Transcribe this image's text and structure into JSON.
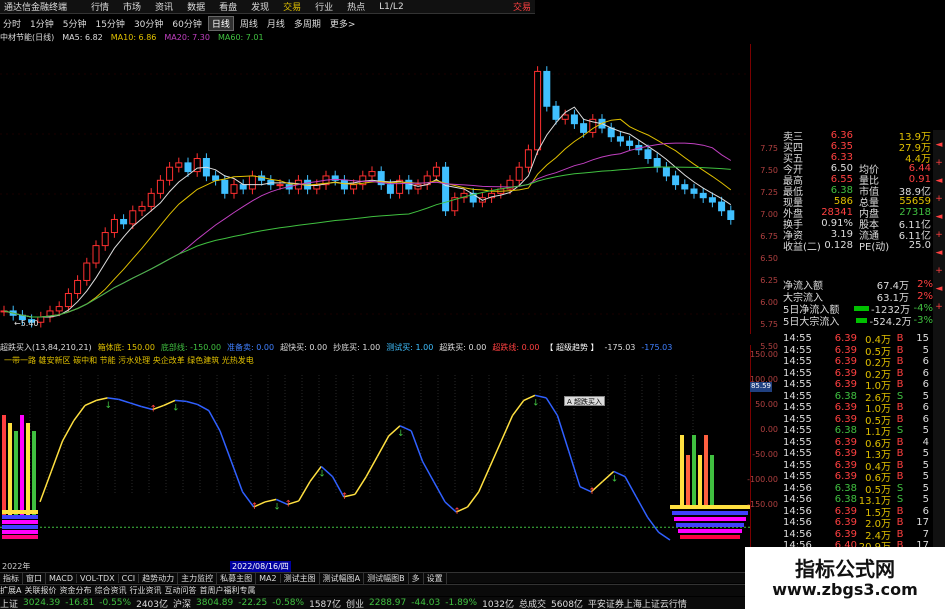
{
  "titlebar": {
    "app_name": "通达信金融终端",
    "menus": [
      "行情",
      "市场",
      "资讯",
      "数据",
      "看盘",
      "发现",
      "交易",
      "行业",
      "热点",
      "L1/L2"
    ],
    "right_label": "交易"
  },
  "period_tabs": [
    "分时",
    "1分钟",
    "5分钟",
    "15分钟",
    "30分钟",
    "60分钟",
    "日线",
    "周线",
    "月线",
    "多周期",
    "更多>"
  ],
  "active_period": "日线",
  "ma_info": {
    "name": "中材节能(日线)",
    "ma5": "MA5: 6.82",
    "ma10": "MA10: 6.86",
    "ma20": "MA20: 7.30",
    "ma60": "MA60: 7.01"
  },
  "low_marker": "5.40",
  "price_axis": [
    "7.75",
    "7.50",
    "7.25",
    "7.00",
    "6.75",
    "6.50",
    "6.25",
    "6.00",
    "5.75",
    "5.50"
  ],
  "indicator_info": [
    {
      "text": "超跌买入(13,84,210,21)",
      "color": "#dddddd"
    },
    {
      "text": "箱体底: 150.00",
      "color": "#e0c000"
    },
    {
      "text": "底部线: -150.00",
      "color": "#40c040"
    },
    {
      "text": "准备卖: 0.00",
      "color": "#4080ff"
    },
    {
      "text": "超快买: 0.00",
      "color": "#dddddd"
    },
    {
      "text": "抄底买: 1.00",
      "color": "#dddddd"
    },
    {
      "text": "测试买: 1.00",
      "color": "#40c0ff"
    },
    {
      "text": "超跌买: 0.00",
      "color": "#dddddd"
    },
    {
      "text": "超跌线: 0.00",
      "color": "#ff4040"
    },
    {
      "text": "【 超级趋势 】",
      "color": "#ffffff"
    },
    {
      "text": "-175.03",
      "color": "#dddddd"
    },
    {
      "text": "-175.03",
      "color": "#4080ff"
    }
  ],
  "tagline": "一带一路 雄安新区 碳中和 节能 污水处理 央企改革 绿色建筑 光热发电",
  "indicator_axis": [
    "150.00",
    "100.00",
    "50.00",
    "0.00",
    "-50.00",
    "-100.00",
    "-150.00"
  ],
  "indicator_flag": "85.59",
  "tooltip_text": "A 超跌买入",
  "year_label": "2022年",
  "date_label": "2022/08/16/四",
  "quote": [
    {
      "l1": "卖三",
      "v1": "6.36",
      "c1": "#ff4040",
      "l2": "",
      "v2": "13.9万",
      "c2": "#e0c000"
    },
    {
      "l1": "买四",
      "v1": "6.35",
      "c1": "#ff4040",
      "l2": "",
      "v2": "27.9万",
      "c2": "#e0c000"
    },
    {
      "l1": "买五",
      "v1": "6.33",
      "c1": "#ff4040",
      "l2": "",
      "v2": "4.4万",
      "c2": "#e0c000"
    },
    {
      "l1": "今开",
      "v1": "6.50",
      "c1": "#dddddd",
      "l2": "均价",
      "v2": "6.44",
      "c2": "#ff4040"
    },
    {
      "l1": "最高",
      "v1": "6.55",
      "c1": "#ff4040",
      "l2": "量比",
      "v2": "0.91",
      "c2": "#ff4040"
    },
    {
      "l1": "最低",
      "v1": "6.38",
      "c1": "#40c040",
      "l2": "市值",
      "v2": "38.9亿",
      "c2": "#dddddd"
    },
    {
      "l1": "现量",
      "v1": "586",
      "c1": "#e0c000",
      "l2": "总量",
      "v2": "55659",
      "c2": "#e0c000"
    },
    {
      "l1": "外盘",
      "v1": "28341",
      "c1": "#ff4040",
      "l2": "内盘",
      "v2": "27318",
      "c2": "#40c040"
    },
    {
      "l1": "换手",
      "v1": "0.91%",
      "c1": "#dddddd",
      "l2": "股本",
      "v2": "6.11亿",
      "c2": "#dddddd"
    },
    {
      "l1": "净资",
      "v1": "3.19",
      "c1": "#dddddd",
      "l2": "流通",
      "v2": "6.11亿",
      "c2": "#dddddd"
    },
    {
      "l1": "收益(二)",
      "v1": "0.128",
      "c1": "#dddddd",
      "l2": "PE(动)",
      "v2": "25.0",
      "c2": "#dddddd"
    }
  ],
  "flow": [
    {
      "label": "净流入额",
      "bar_fraction": 0.0,
      "bar_color": "#ff4040",
      "value": "67.4万",
      "pct": "2%"
    },
    {
      "label": "大宗流入",
      "bar_fraction": 0.0,
      "bar_color": "#ff4040",
      "value": "63.1万",
      "pct": "2%"
    },
    {
      "label": "5日净流入额",
      "bar_fraction": 0.8,
      "bar_color": "#00c000",
      "value": "-1232万",
      "pct": "-4%"
    },
    {
      "label": "5日大宗流入",
      "bar_fraction": 0.6,
      "bar_color": "#00c000",
      "value": "-524.2万",
      "pct": "-3%"
    }
  ],
  "ticks": [
    {
      "t": "14:55",
      "p": "6.39",
      "v": "0.4万",
      "s": "B",
      "n": "15"
    },
    {
      "t": "14:55",
      "p": "6.39",
      "v": "0.5万",
      "s": "B",
      "n": "5"
    },
    {
      "t": "14:55",
      "p": "6.39",
      "v": "0.2万",
      "s": "B",
      "n": "6"
    },
    {
      "t": "14:55",
      "p": "6.39",
      "v": "0.2万",
      "s": "B",
      "n": "6"
    },
    {
      "t": "14:55",
      "p": "6.39",
      "v": "1.0万",
      "s": "B",
      "n": "6"
    },
    {
      "t": "14:55",
      "p": "6.38",
      "v": "2.6万",
      "s": "S",
      "n": "5"
    },
    {
      "t": "14:55",
      "p": "6.39",
      "v": "1.0万",
      "s": "B",
      "n": "6"
    },
    {
      "t": "14:55",
      "p": "6.39",
      "v": "0.5万",
      "s": "B",
      "n": "6"
    },
    {
      "t": "14:55",
      "p": "6.38",
      "v": "1.1万",
      "s": "S",
      "n": "5"
    },
    {
      "t": "14:55",
      "p": "6.39",
      "v": "0.6万",
      "s": "B",
      "n": "4"
    },
    {
      "t": "14:55",
      "p": "6.39",
      "v": "1.3万",
      "s": "B",
      "n": "5"
    },
    {
      "t": "14:55",
      "p": "6.39",
      "v": "0.4万",
      "s": "B",
      "n": "5"
    },
    {
      "t": "14:55",
      "p": "6.39",
      "v": "0.6万",
      "s": "B",
      "n": "5"
    },
    {
      "t": "14:56",
      "p": "6.38",
      "v": "0.5万",
      "s": "S",
      "n": "5"
    },
    {
      "t": "14:56",
      "p": "6.38",
      "v": "13.1万",
      "s": "S",
      "n": "5"
    },
    {
      "t": "14:56",
      "p": "6.39",
      "v": "1.5万",
      "s": "B",
      "n": "6"
    },
    {
      "t": "14:56",
      "p": "6.39",
      "v": "2.0万",
      "s": "B",
      "n": "17"
    },
    {
      "t": "14:56",
      "p": "6.39",
      "v": "2.4万",
      "s": "B",
      "n": "7"
    },
    {
      "t": "14:56",
      "p": "6.40",
      "v": "20.9万",
      "s": "B",
      "n": "17"
    },
    {
      "t": "14:56",
      "p": "6.40",
      "v": "1.7万",
      "s": "S",
      "n": "17"
    }
  ],
  "sidebar_buttons": [
    "◄",
    "+",
    "◄",
    "+",
    "◄",
    "+",
    "◄",
    "+",
    "◄",
    "+"
  ],
  "bottom_tabs": [
    "指标",
    "窗口",
    "MACD",
    "VOL-TDX",
    "CCI",
    "趋势动力",
    "主力监控",
    "私募主图",
    "MA2",
    "测试主图",
    "测试幅图A",
    "测试幅图B",
    "多",
    "设置"
  ],
  "statusbar": [
    "扩展A",
    "关联报价",
    "资金分布",
    "综合资讯",
    "行业资讯",
    "互动问答",
    "首周户福利专属"
  ],
  "indexbar": [
    {
      "text": "上证",
      "color": "#dddddd"
    },
    {
      "text": "3024.39",
      "color": "#40c040"
    },
    {
      "text": "-16.81",
      "color": "#40c040"
    },
    {
      "text": "-0.55%",
      "color": "#40c040"
    },
    {
      "text": "2403亿",
      "color": "#dddddd"
    },
    {
      "text": "沪深",
      "color": "#dddddd"
    },
    {
      "text": "3804.89",
      "color": "#40c040"
    },
    {
      "text": "-22.25",
      "color": "#40c040"
    },
    {
      "text": "-0.58%",
      "color": "#40c040"
    },
    {
      "text": "1587亿",
      "color": "#dddddd"
    },
    {
      "text": "创业",
      "color": "#dddddd"
    },
    {
      "text": "2288.97",
      "color": "#40c040"
    },
    {
      "text": "-44.03",
      "color": "#40c040"
    },
    {
      "text": "-1.89%",
      "color": "#40c040"
    },
    {
      "text": "1032亿",
      "color": "#dddddd"
    },
    {
      "text": "总成交",
      "color": "#dddddd"
    },
    {
      "text": "5608亿",
      "color": "#dddddd"
    },
    {
      "text": "平安证券上海上证云行情",
      "color": "#dddddd"
    }
  ],
  "watermark": {
    "line1": "指标公式网",
    "line2": "www.zbgs3.com"
  },
  "chart_data": {
    "type": "line",
    "candles_close": [
      5.55,
      5.5,
      5.45,
      5.42,
      5.48,
      5.55,
      5.6,
      5.75,
      5.9,
      6.1,
      6.3,
      6.45,
      6.6,
      6.55,
      6.7,
      6.75,
      6.9,
      7.05,
      7.2,
      7.25,
      7.15,
      7.3,
      7.1,
      7.05,
      6.9,
      7.0,
      6.95,
      7.1,
      7.05,
      7.0,
      7.0,
      6.95,
      7.05,
      6.95,
      7.0,
      7.1,
      7.05,
      6.95,
      7.0,
      7.1,
      7.15,
      7.0,
      6.9,
      7.05,
      6.95,
      7.0,
      7.1,
      7.2,
      6.7,
      6.85,
      6.9,
      6.8,
      6.85,
      6.9,
      6.95,
      7.05,
      7.2,
      7.4,
      8.3,
      7.9,
      7.75,
      7.8,
      7.7,
      7.6,
      7.75,
      7.65,
      7.55,
      7.5,
      7.45,
      7.4,
      7.3,
      7.2,
      7.1,
      7.0,
      6.95,
      6.9,
      6.85,
      6.8,
      6.7,
      6.6
    ],
    "oscillator": [
      -100,
      -40,
      20,
      60,
      90,
      100,
      105,
      102,
      95,
      88,
      82,
      90,
      100,
      98,
      92,
      80,
      40,
      -20,
      -80,
      -110,
      -100,
      -95,
      -105,
      -98,
      -60,
      -30,
      -50,
      -90,
      -85,
      -50,
      -10,
      30,
      50,
      40,
      -20,
      -60,
      -100,
      -120,
      -110,
      -80,
      -30,
      20,
      70,
      100,
      110,
      105,
      70,
      0,
      -70,
      -80,
      -60,
      -40,
      -50,
      -90,
      -130,
      -160,
      -175
    ],
    "ylim_price": [
      5.4,
      8.5
    ],
    "ylim_oscillator": [
      -175,
      150
    ]
  }
}
